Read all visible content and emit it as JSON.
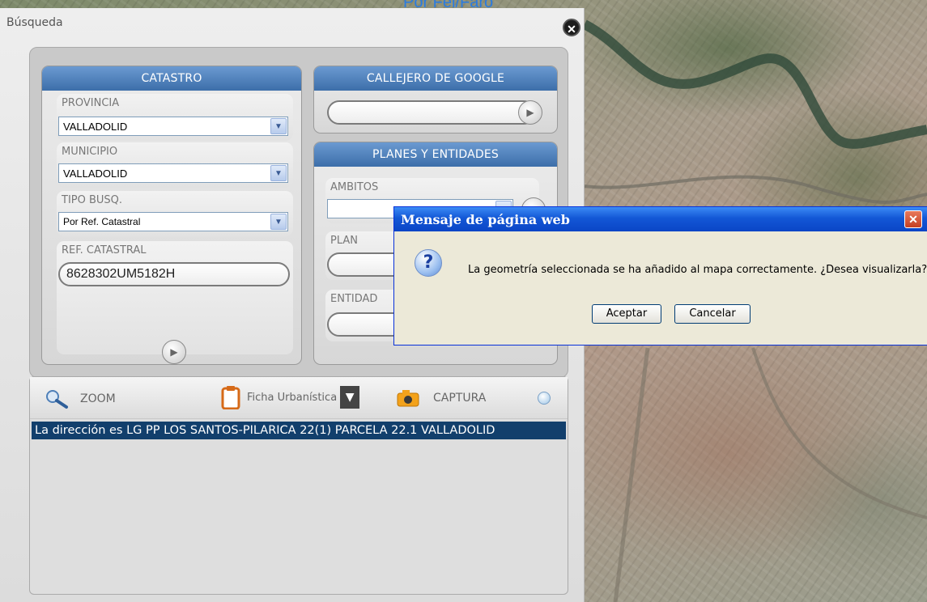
{
  "top_link": "Por Fel/Faro",
  "panel": {
    "title": "Búsqueda",
    "close_icon": "close-icon"
  },
  "catastro": {
    "header": "CATASTRO",
    "provincia_label": "PROVINCIA",
    "provincia_value": "VALLADOLID",
    "municipio_label": "MUNICIPIO",
    "municipio_value": "VALLADOLID",
    "tipo_label": "TIPO BUSQ.",
    "tipo_value": "Por Ref. Catastral",
    "ref_label": "REF. CATASTRAL",
    "ref_value": "8628302UM5182H"
  },
  "callejero": {
    "header": "CALLEJERO DE GOOGLE",
    "input_value": ""
  },
  "planes": {
    "header": "PLANES Y ENTIDADES",
    "ambitos_label": "AMBITOS",
    "ambitos_value": "",
    "plan_label": "PLAN",
    "entidad_label": "ENTIDAD"
  },
  "toolbar": {
    "zoom_label": "ZOOM",
    "ficha_label": "Ficha Urbanística",
    "captura_label": "CAPTURA"
  },
  "results": {
    "line": "La dirección es LG PP LOS SANTOS-PILARICA 22(1) PARCELA 22.1 VALLADOLID"
  },
  "dialog": {
    "title": "Mensaje de página web",
    "message": "La geometría seleccionada se ha añadido al mapa correctamente. ¿Desea visualizarla?",
    "accept_label": "Aceptar",
    "cancel_label": "Cancelar"
  },
  "colors": {
    "section_header": "#3c6ea9",
    "results_highlight": "#123f6c",
    "dialog_titlebar": "#0a45c6"
  }
}
